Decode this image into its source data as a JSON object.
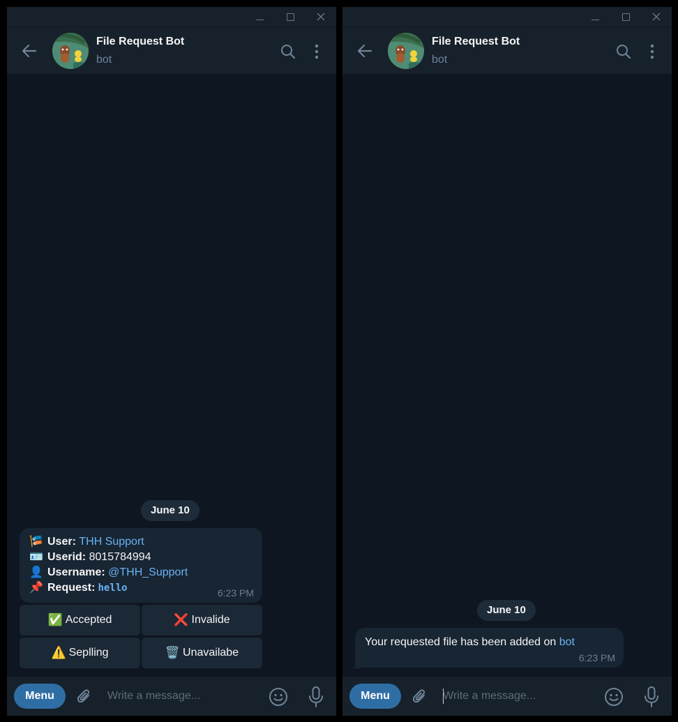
{
  "left_window": {
    "header": {
      "title": "File Request Bot",
      "status": "bot"
    },
    "date_label": "June 10",
    "message": {
      "user_label": "User:",
      "user_value": "THH Support",
      "userid_label": "Userid:",
      "userid_value": "8015784994",
      "username_label": "Username:",
      "username_value": "@THH_Support",
      "request_label": "Request:",
      "request_value": "hello",
      "time": "6:23 PM",
      "emojis": [
        "🎏",
        "🪪",
        "👤",
        "📌"
      ]
    },
    "keyboard": {
      "accepted": {
        "emoji": "✅",
        "label": "Accepted"
      },
      "invalide": {
        "emoji": "❌",
        "label": "Invalide"
      },
      "sepling": {
        "emoji": "⚠️",
        "label": "Seplling"
      },
      "unavailable": {
        "emoji": "🗑️",
        "label": "Unavailabe"
      }
    },
    "composer": {
      "menu_label": "Menu",
      "placeholder": "Write a message..."
    }
  },
  "right_window": {
    "header": {
      "title": "File Request Bot",
      "status": "bot"
    },
    "date_label": "June 10",
    "message": {
      "text": "Your requested file has been added on",
      "link": "bot",
      "time": "6:23 PM"
    },
    "composer": {
      "menu_label": "Menu",
      "placeholder": "Write a message..."
    }
  },
  "colors": {
    "chat_bg": "#0e1621",
    "header_bg": "#17212b",
    "bubble_bg": "#182533",
    "link": "#6ab3f3",
    "menu_button": "#2f6ea5",
    "muted_text": "#708499"
  },
  "icons": [
    "back-arrow-icon",
    "search-icon",
    "more-vertical-icon",
    "attach-icon",
    "emoji-icon",
    "microphone-icon",
    "minimize-icon",
    "maximize-icon",
    "close-icon"
  ]
}
